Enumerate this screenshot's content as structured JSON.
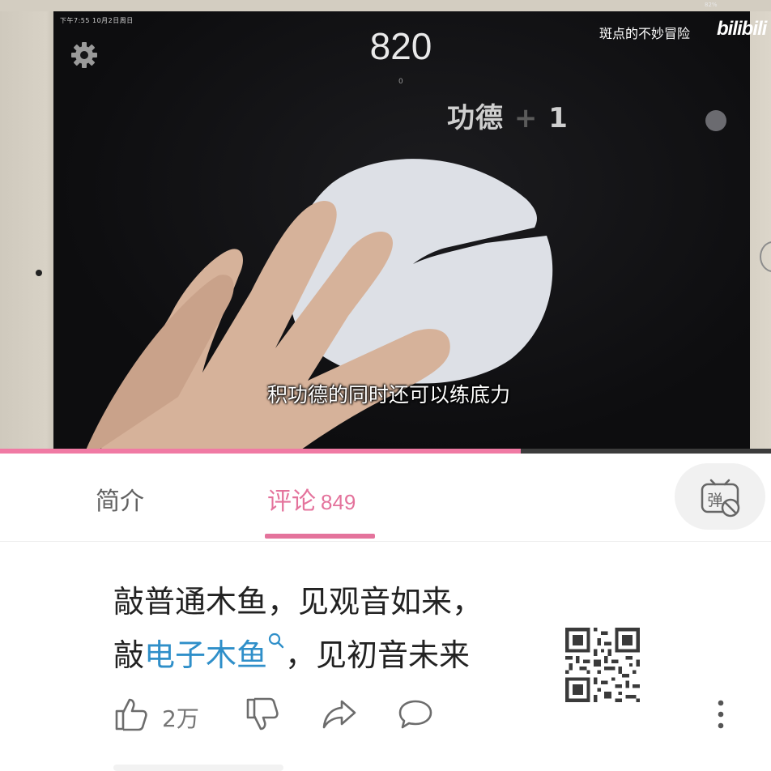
{
  "video": {
    "status_time": "下午7:55  10月2日周日",
    "battery": "82%",
    "score": "820",
    "score_sub": "0",
    "merit_text": "功德",
    "merit_plus": "+",
    "merit_value": "1",
    "uploader": "斑点的不妙冒险",
    "platform_logo": "bilibili",
    "subtitle": "积功德的同时还可以练底力",
    "progress": 0.675
  },
  "tabs": {
    "intro": "简介",
    "comments": "评论",
    "comments_count": "849",
    "danmaku_icon": "danmaku-off-icon"
  },
  "comment": {
    "line1": "敲普通木鱼，见观音如来，",
    "line2_prefix": "敲",
    "line2_link": "电子木鱼",
    "line2_suffix": "，见初音未来",
    "like_count": "2万"
  },
  "colors": {
    "accent": "#e4739c",
    "link": "#2f8fc9",
    "progress": "#f07aa4"
  }
}
